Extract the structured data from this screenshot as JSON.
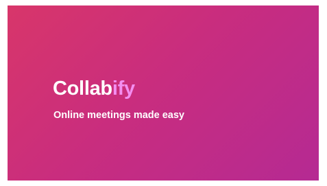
{
  "hero": {
    "brand_main": "Collab",
    "brand_accent": "ify",
    "tagline": "Online meetings made easy"
  },
  "colors": {
    "gradient_start": "#d8366a",
    "gradient_end": "#b52a93",
    "brand_accent": "#f38ef0",
    "text": "#ffffff"
  }
}
